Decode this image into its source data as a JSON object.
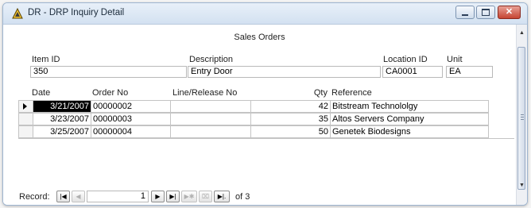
{
  "window": {
    "title": "DR - DRP Inquiry Detail"
  },
  "section": {
    "title": "Sales Orders"
  },
  "header_fields": {
    "item_id": {
      "label": "Item ID",
      "value": "350"
    },
    "description": {
      "label": "Description",
      "value": "Entry Door"
    },
    "location_id": {
      "label": "Location ID",
      "value": "CA0001"
    },
    "unit": {
      "label": "Unit",
      "value": "EA"
    }
  },
  "grid": {
    "columns": [
      "Date",
      "Order No",
      "Line/Release No",
      "Qty",
      "Reference"
    ],
    "rows": [
      {
        "date": "3/21/2007",
        "order_no": "00000002",
        "line_release_no": "",
        "qty": "42",
        "reference": "Bitstream Technololgy"
      },
      {
        "date": "3/23/2007",
        "order_no": "00000003",
        "line_release_no": "",
        "qty": "35",
        "reference": "Altos Servers Company"
      },
      {
        "date": "3/25/2007",
        "order_no": "00000004",
        "line_release_no": "",
        "qty": "50",
        "reference": "Genetek Biodesigns"
      }
    ]
  },
  "nav": {
    "record_label": "Record:",
    "current": "1",
    "of_label": "of 3"
  },
  "colors": {
    "title_gradient": "#d3e1f1",
    "close_button": "#c64532",
    "selection": "#000000"
  }
}
